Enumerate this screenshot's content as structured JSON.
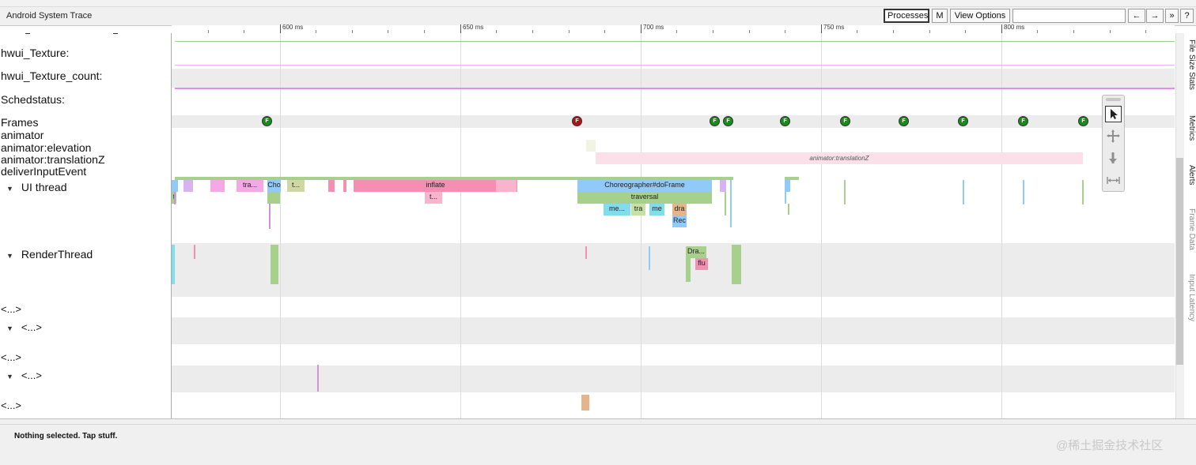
{
  "header": {
    "title": "Android System Trace",
    "buttons": {
      "processes": "Processes",
      "metadata": "M",
      "view_options": "View Options",
      "prev": "←",
      "next": "→",
      "more": "»",
      "help": "?"
    },
    "search_value": ""
  },
  "ruler": {
    "ticks": [
      "600 ms",
      "650 ms",
      "700 ms",
      "750 ms",
      "800 ms"
    ]
  },
  "tracks": {
    "hwui_texture": "hwui_Texture:",
    "hwui_texture_count": "hwui_Texture_count:",
    "schedstatus": "Schedstatus:",
    "frames": "Frames",
    "animator": "animator",
    "animator_elevation": "animator:elevation",
    "animator_translationz": "animator:translationZ",
    "deliver_input": "deliverInputEvent",
    "ui_thread": "UI thread",
    "render_thread": "RenderThread",
    "collapsed_1": "<...>",
    "collapsed_2": "<...>",
    "collapsed_3": "<...>",
    "collapsed_4": "<...>",
    "collapsed_5": "<...>"
  },
  "frame_markers": [
    "F",
    "F",
    "F",
    "F",
    "F",
    "F",
    "F",
    "F",
    "F",
    "F"
  ],
  "slices": {
    "animator_translationz": "animator:translationZ",
    "ui_tra": "tra...",
    "ui_cho": "Cho",
    "ui_t1": "t...",
    "ui_inflate": "inflate",
    "ui_t2": "t...",
    "ui_t3": "t",
    "ui_doframe": "Choreographer#doFrame",
    "ui_traversal": "traversal",
    "ui_me1": "me...",
    "ui_tra2": "tra",
    "ui_me2": "me",
    "ui_dra": "dra",
    "ui_rec": "Rec",
    "rt_dra": "Dra...",
    "rt_flu": "flu"
  },
  "side_tabs": {
    "file_size": "File Size Stats",
    "metrics": "Metrics",
    "alerts": "Alerts",
    "frame_data": "Frame Data",
    "input_latency": "Input Latency"
  },
  "status": {
    "text": "Nothing selected. Tap stuff.",
    "watermark": "@稀土掘金技术社区"
  },
  "colors": {
    "frame_good": "#1a8a1a",
    "frame_bad": "#b01515",
    "inflate": "#f48fb1",
    "doframe": "#90caf9",
    "traversal": "#aed581"
  }
}
